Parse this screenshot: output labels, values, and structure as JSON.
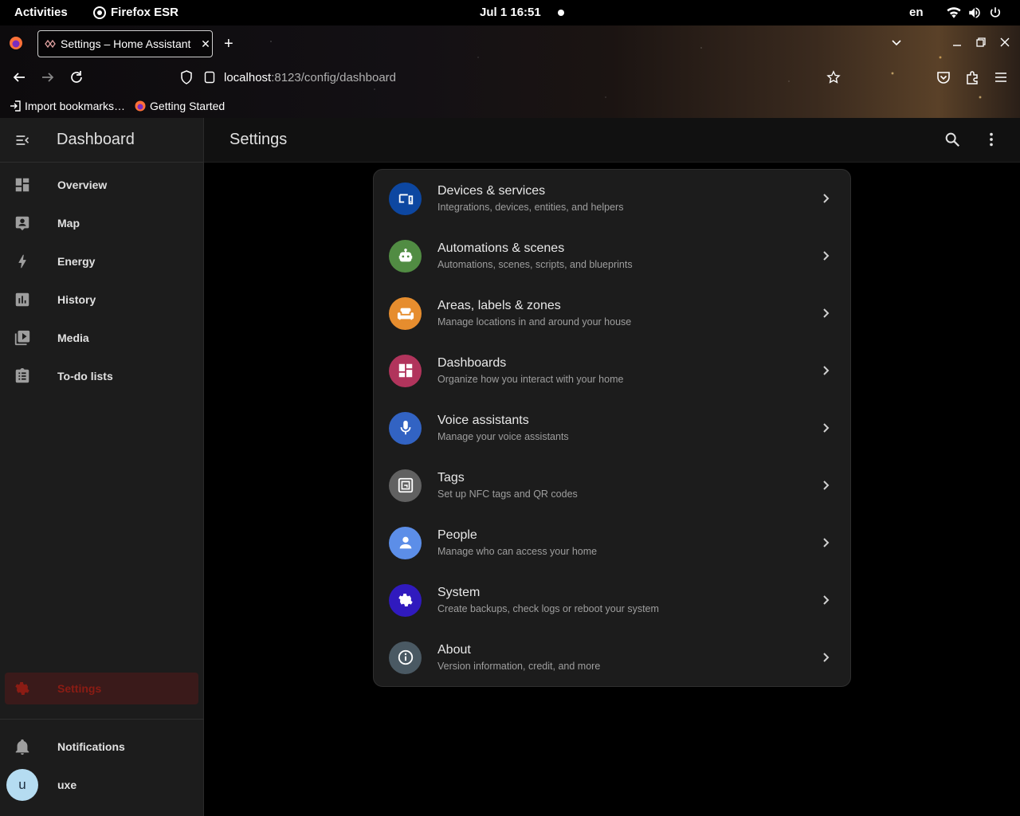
{
  "system_bar": {
    "activities": "Activities",
    "app_name": "Firefox ESR",
    "clock": "Jul 1  16:51",
    "language": "en"
  },
  "browser": {
    "tab_title": "Settings – Home Assistant",
    "url_host": "localhost",
    "url_path": ":8123/config/dashboard",
    "bookmarks": [
      {
        "label": "Import bookmarks…"
      },
      {
        "label": "Getting Started"
      }
    ]
  },
  "sidebar": {
    "title": "Dashboard",
    "items": [
      {
        "label": "Overview",
        "icon": "view-dashboard-icon"
      },
      {
        "label": "Map",
        "icon": "map-account-icon"
      },
      {
        "label": "Energy",
        "icon": "lightning-icon"
      },
      {
        "label": "History",
        "icon": "chart-box-icon"
      },
      {
        "label": "Media",
        "icon": "play-box-multiple-icon"
      },
      {
        "label": "To-do lists",
        "icon": "clipboard-list-icon"
      }
    ],
    "settings_label": "Settings",
    "notifications_label": "Notifications",
    "user_initial": "u",
    "user_name": "uxe",
    "active_color": "#8b1c14"
  },
  "main": {
    "page_title": "Settings",
    "rows": [
      {
        "title": "Devices & services",
        "subtitle": "Integrations, devices, entities, and helpers",
        "color": "#0d47a1",
        "icon": "devices-icon"
      },
      {
        "title": "Automations & scenes",
        "subtitle": "Automations, scenes, scripts, and blueprints",
        "color": "#518c43",
        "icon": "robot-icon"
      },
      {
        "title": "Areas, labels & zones",
        "subtitle": "Manage locations in and around your house",
        "color": "#e68d2e",
        "icon": "sofa-icon"
      },
      {
        "title": "Dashboards",
        "subtitle": "Organize how you interact with your home",
        "color": "#b1345c",
        "icon": "dashboard-icon"
      },
      {
        "title": "Voice assistants",
        "subtitle": "Manage your voice assistants",
        "color": "#3263c3",
        "icon": "microphone-icon"
      },
      {
        "title": "Tags",
        "subtitle": "Set up NFC tags and QR codes",
        "color": "#616161",
        "icon": "nfc-tag-icon"
      },
      {
        "title": "People",
        "subtitle": "Manage who can access your home",
        "color": "#5c8ee8",
        "icon": "account-icon"
      },
      {
        "title": "System",
        "subtitle": "Create backups, check logs or reboot your system",
        "color": "#301ABE",
        "icon": "cog-icon"
      },
      {
        "title": "About",
        "subtitle": "Version information, credit, and more",
        "color": "#4a5963",
        "icon": "information-icon"
      }
    ]
  }
}
